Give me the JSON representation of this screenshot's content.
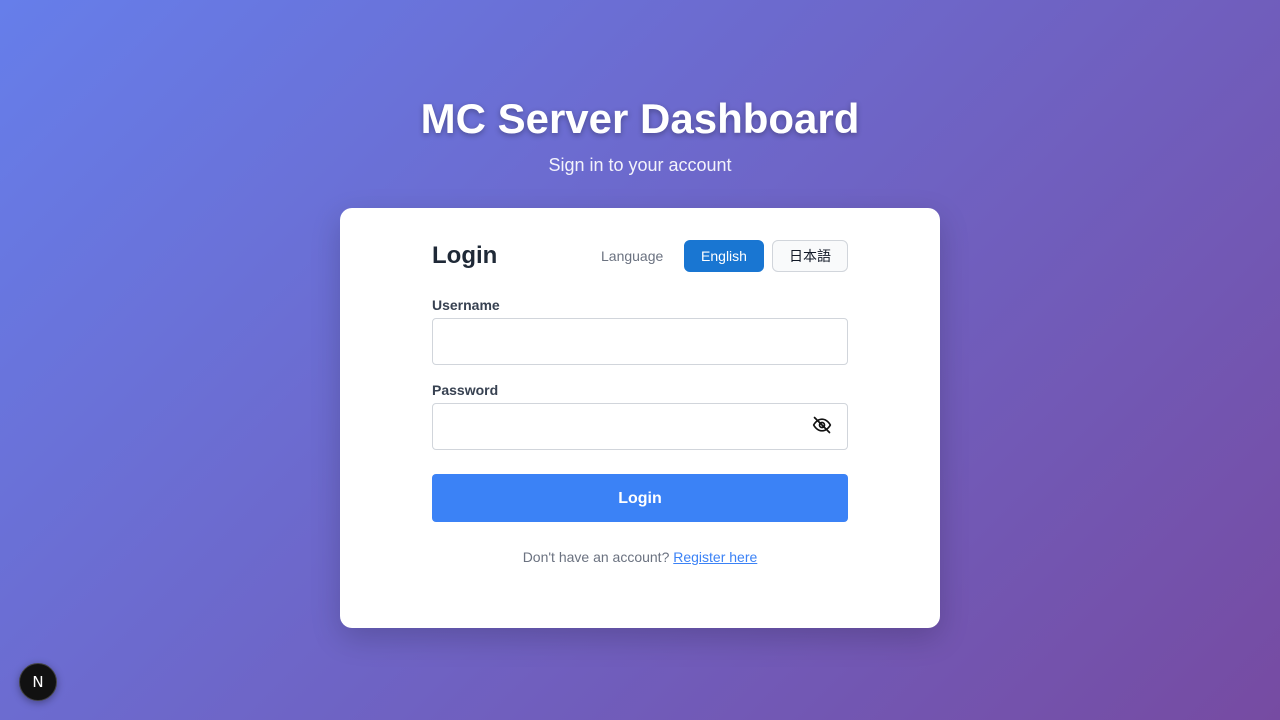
{
  "page": {
    "title": "MC Server Dashboard",
    "subtitle": "Sign in to your account"
  },
  "login_card": {
    "heading": "Login",
    "language": {
      "label": "Language",
      "options": [
        "English",
        "日本語"
      ],
      "selected": "English"
    },
    "username": {
      "label": "Username",
      "value": "",
      "placeholder": ""
    },
    "password": {
      "label": "Password",
      "value": "",
      "placeholder": "",
      "toggle_icon": "eye-off-icon"
    },
    "submit_label": "Login",
    "register_prompt": "Don't have an account?",
    "register_link": "Register here"
  },
  "dev_badge": {
    "letter": "N",
    "icon": "nextjs-logo-icon"
  },
  "colors": {
    "background_start": "#667eea",
    "background_end": "#764ba2",
    "primary_button": "#3b82f6",
    "active_language": "#1976d2",
    "link": "#3b82f6"
  }
}
